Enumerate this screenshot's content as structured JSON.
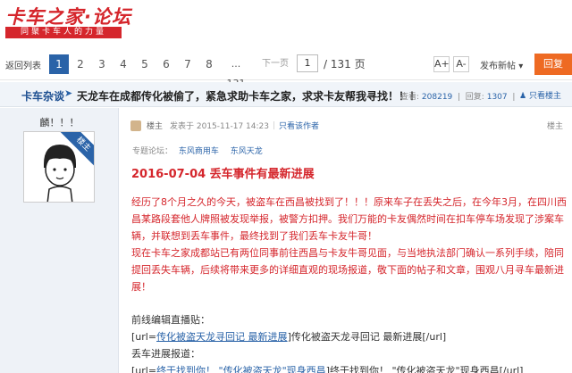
{
  "logo": {
    "title": "卡车之家·论坛",
    "tagline": "同聚卡车人的力量"
  },
  "pagination": {
    "back": "返回列表",
    "pages": [
      "1",
      "2",
      "3",
      "4",
      "5",
      "6",
      "7",
      "8"
    ],
    "ellipsis": "... 131",
    "next": "下一页",
    "current_input": "1",
    "total": "/ 131 页",
    "font_up": "A+",
    "font_down": "A-",
    "new_post": "发布新帖",
    "reply": "回复"
  },
  "thread": {
    "board": "卡车杂谈",
    "title": "天龙车在成都传化被偷了，紧急求助卡车之家，求求卡友帮我寻找！！！",
    "views_label": "查看:",
    "views": "208219",
    "replies_label": "回复:",
    "replies": "1307",
    "author_only": "只看楼主"
  },
  "profile": {
    "username": "麟！！！",
    "badge": "楼主"
  },
  "post": {
    "owner_tag": "楼主",
    "posted": "发表于 2015-11-17 14:23",
    "only_this": "只看该作者",
    "floor": "楼主",
    "forum_label": "专题论坛：",
    "forum_tag1": "东风商用车",
    "forum_tag2": "东风天龙",
    "heading": "2016-07-04 丢车事件有最新进展",
    "para1": "经历了8个月之久的今天，被盗车在西昌被找到了！！！原来车子在丢失之后，在今年3月，在四川西昌某路段套他人牌照被发现举报，被警方扣押。我们万能的卡友偶然时间在扣车停车场发现了涉案车辆，并联想到丢车事件，最终找到了我们丢车卡友牛哥！",
    "para2": "现在卡车之家成都站已有两位同事前往西昌与卡友牛哥见面，与当地执法部门确认一系列手续，陪同提回丢失车辆，后续将带来更多的详细直观的现场报道，敬下面的帖子和文章，围观八月寻车最新进展！",
    "line1": "前线编辑直播贴：",
    "line2_prefix": "[url=",
    "line2_link": "传化被盗天龙寻回记 最新进展",
    "line2_suffix": "]传化被盗天龙寻回记 最新进展[/url]",
    "line3": "丢车进展报道：",
    "line4_prefix": "[url=",
    "line4_link": "终于找到你！ \"传化被盗天龙\"现身西昌",
    "line4_suffix": "]终于找到你！ \"传化被盗天龙\"现身西昌[/url]"
  }
}
